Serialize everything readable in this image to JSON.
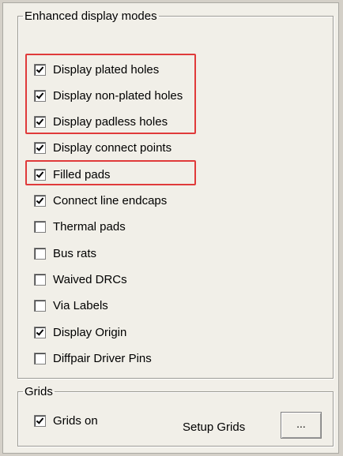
{
  "enhanced_display": {
    "legend": "Enhanced display modes",
    "items": [
      {
        "label": "Display plated holes",
        "checked": true,
        "highlighted": true
      },
      {
        "label": "Display non-plated holes",
        "checked": true,
        "highlighted": true
      },
      {
        "label": "Display padless holes",
        "checked": true,
        "highlighted": true
      },
      {
        "label": "Display connect points",
        "checked": true,
        "highlighted": false
      },
      {
        "label": "Filled pads",
        "checked": true,
        "highlighted": true
      },
      {
        "label": "Connect line endcaps",
        "checked": true,
        "highlighted": false
      },
      {
        "label": "Thermal pads",
        "checked": false,
        "highlighted": false
      },
      {
        "label": "Bus rats",
        "checked": false,
        "highlighted": false
      },
      {
        "label": "Waived DRCs",
        "checked": false,
        "highlighted": false
      },
      {
        "label": "Via Labels",
        "checked": false,
        "highlighted": false
      },
      {
        "label": "Display Origin",
        "checked": true,
        "highlighted": false
      },
      {
        "label": "Diffpair Driver Pins",
        "checked": false,
        "highlighted": false
      }
    ]
  },
  "grids": {
    "legend": "Grids",
    "grids_on_label": "Grids on",
    "grids_on_checked": true,
    "setup_label": "Setup Grids",
    "setup_button_label": "..."
  },
  "colors": {
    "highlight": "#e03a3a",
    "panel_background": "#f1efe8"
  }
}
